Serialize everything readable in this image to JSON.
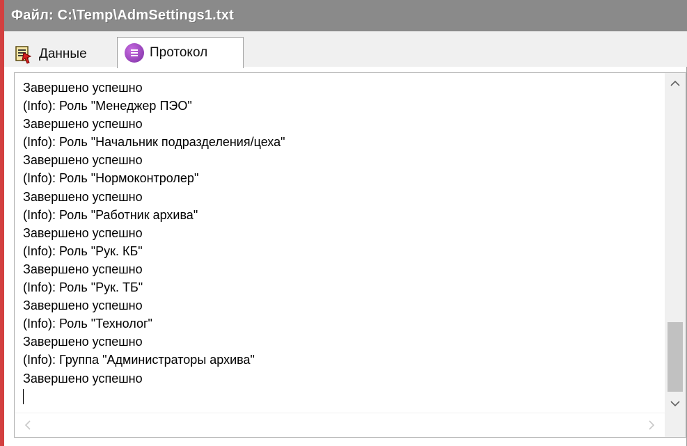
{
  "window": {
    "title": "Файл: C:\\Temp\\AdmSettings1.txt"
  },
  "tabs": [
    {
      "label": "Данные",
      "icon": "data-icon",
      "active": false
    },
    {
      "label": "Протокол",
      "icon": "protocol-icon",
      "active": true
    }
  ],
  "log": {
    "lines": [
      "Завершено успешно",
      "(Info): Роль \"Менеджер ПЭО\"",
      "Завершено успешно",
      "(Info): Роль \"Начальник подразделения/цеха\"",
      "Завершено успешно",
      "(Info): Роль \"Нормоконтролер\"",
      "Завершено успешно",
      "(Info): Роль \"Работник архива\"",
      "Завершено успешно",
      "(Info): Роль \"Рук. КБ\"",
      "Завершено успешно",
      "(Info): Роль \"Рук. ТБ\"",
      "Завершено успешно",
      "(Info): Роль \"Технолог\"",
      "Завершено успешно",
      "(Info): Группа \"Администраторы архива\"",
      "Завершено успешно"
    ]
  },
  "scrollbars": {
    "up_icon": "chevron-up-icon",
    "down_icon": "chevron-down-icon",
    "left_icon": "chevron-left-icon",
    "right_icon": "chevron-right-icon",
    "vertical_position": 0.95
  },
  "colors": {
    "titlebar": "#8a8a8a",
    "accent_border": "#d34040",
    "protocol_icon": "#9b45c4"
  }
}
